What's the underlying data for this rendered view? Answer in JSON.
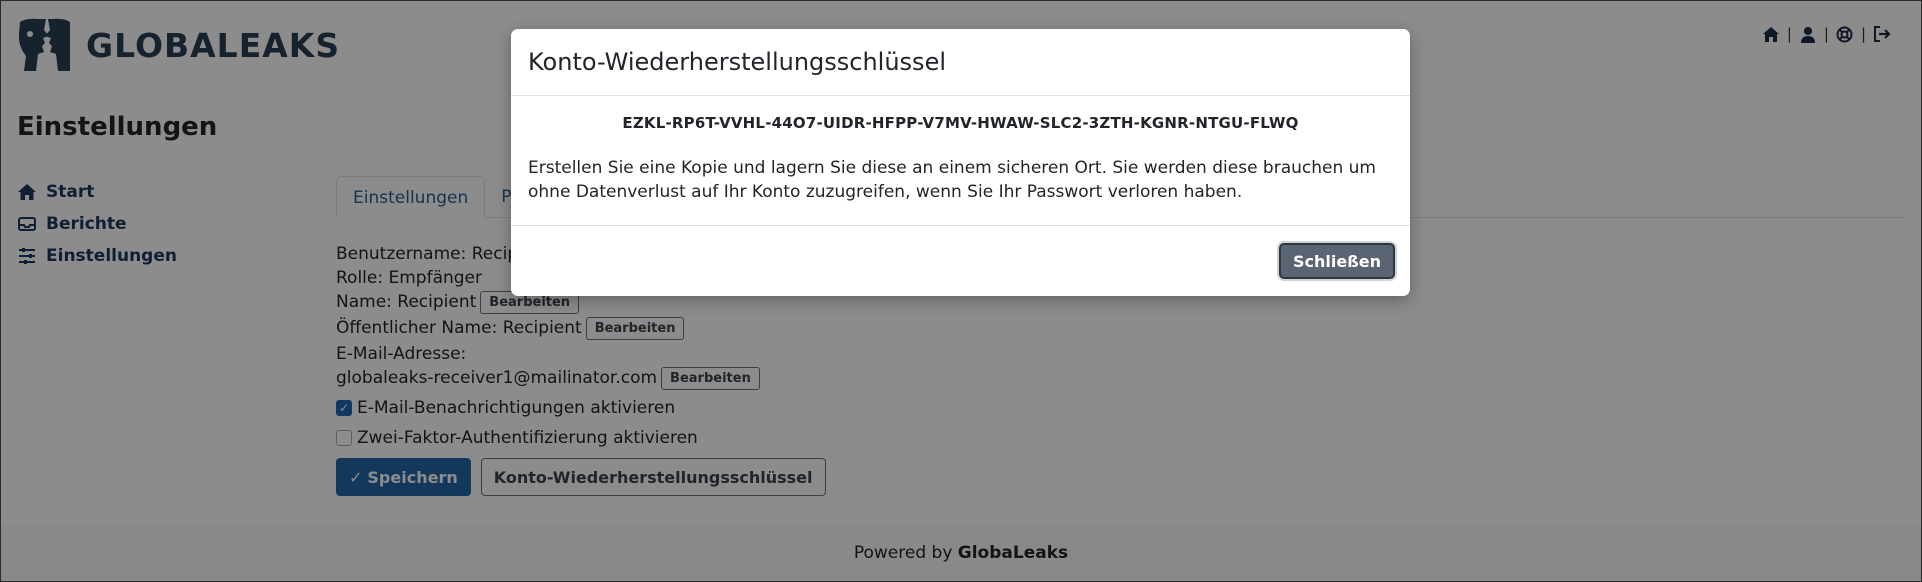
{
  "header": {
    "logo_text": "GLOBALEAKS",
    "icons": [
      "home-icon",
      "user-icon",
      "support-icon",
      "logout-icon"
    ]
  },
  "page_title": "Einstellungen",
  "sidebar": {
    "items": [
      {
        "label": "Start",
        "icon": "home-icon"
      },
      {
        "label": "Berichte",
        "icon": "inbox-icon"
      },
      {
        "label": "Einstellungen",
        "icon": "sliders-icon"
      }
    ]
  },
  "tabs": [
    "Einstellungen",
    "Pa"
  ],
  "profile": {
    "username": "Benutzername: Recipient",
    "role": "Rolle: Empfänger",
    "name": "Name: Recipient",
    "public_name": "Öffentlicher Name: Recipient",
    "email_label": "E-Mail-Adresse:",
    "email_value": "globaleaks-receiver1@mailinator.com",
    "edit_label": "Bearbeiten",
    "email_notifications": "E-Mail-Benachrichtigungen aktivieren",
    "email_notifications_checked": true,
    "two_factor": "Zwei-Faktor-Authentifizierung aktivieren",
    "two_factor_checked": false,
    "save_label": "Speichern",
    "recovery_key_button": "Konto-Wiederherstellungsschlüssel"
  },
  "footer": {
    "prefix": "Powered by",
    "brand": "GlobaLeaks"
  },
  "modal": {
    "title": "Konto-Wiederherstellungsschlüssel",
    "key": "EZKL-RP6T-VVHL-44O7-UIDR-HFPP-V7MV-HWAW-SLC2-3ZTH-KGNR-NTGU-FLWQ",
    "text": "Erstellen Sie eine Kopie und lagern Sie diese an einem sicheren Ort. Sie werden diese brauchen um ohne Datenverlust auf Ihr Konto zuzugreifen, wenn Sie Ihr Passwort verloren haben.",
    "close_label": "Schließen"
  },
  "colors": {
    "brand": "#2b3f56",
    "primary": "#2566a8",
    "link": "#2a5d91"
  }
}
